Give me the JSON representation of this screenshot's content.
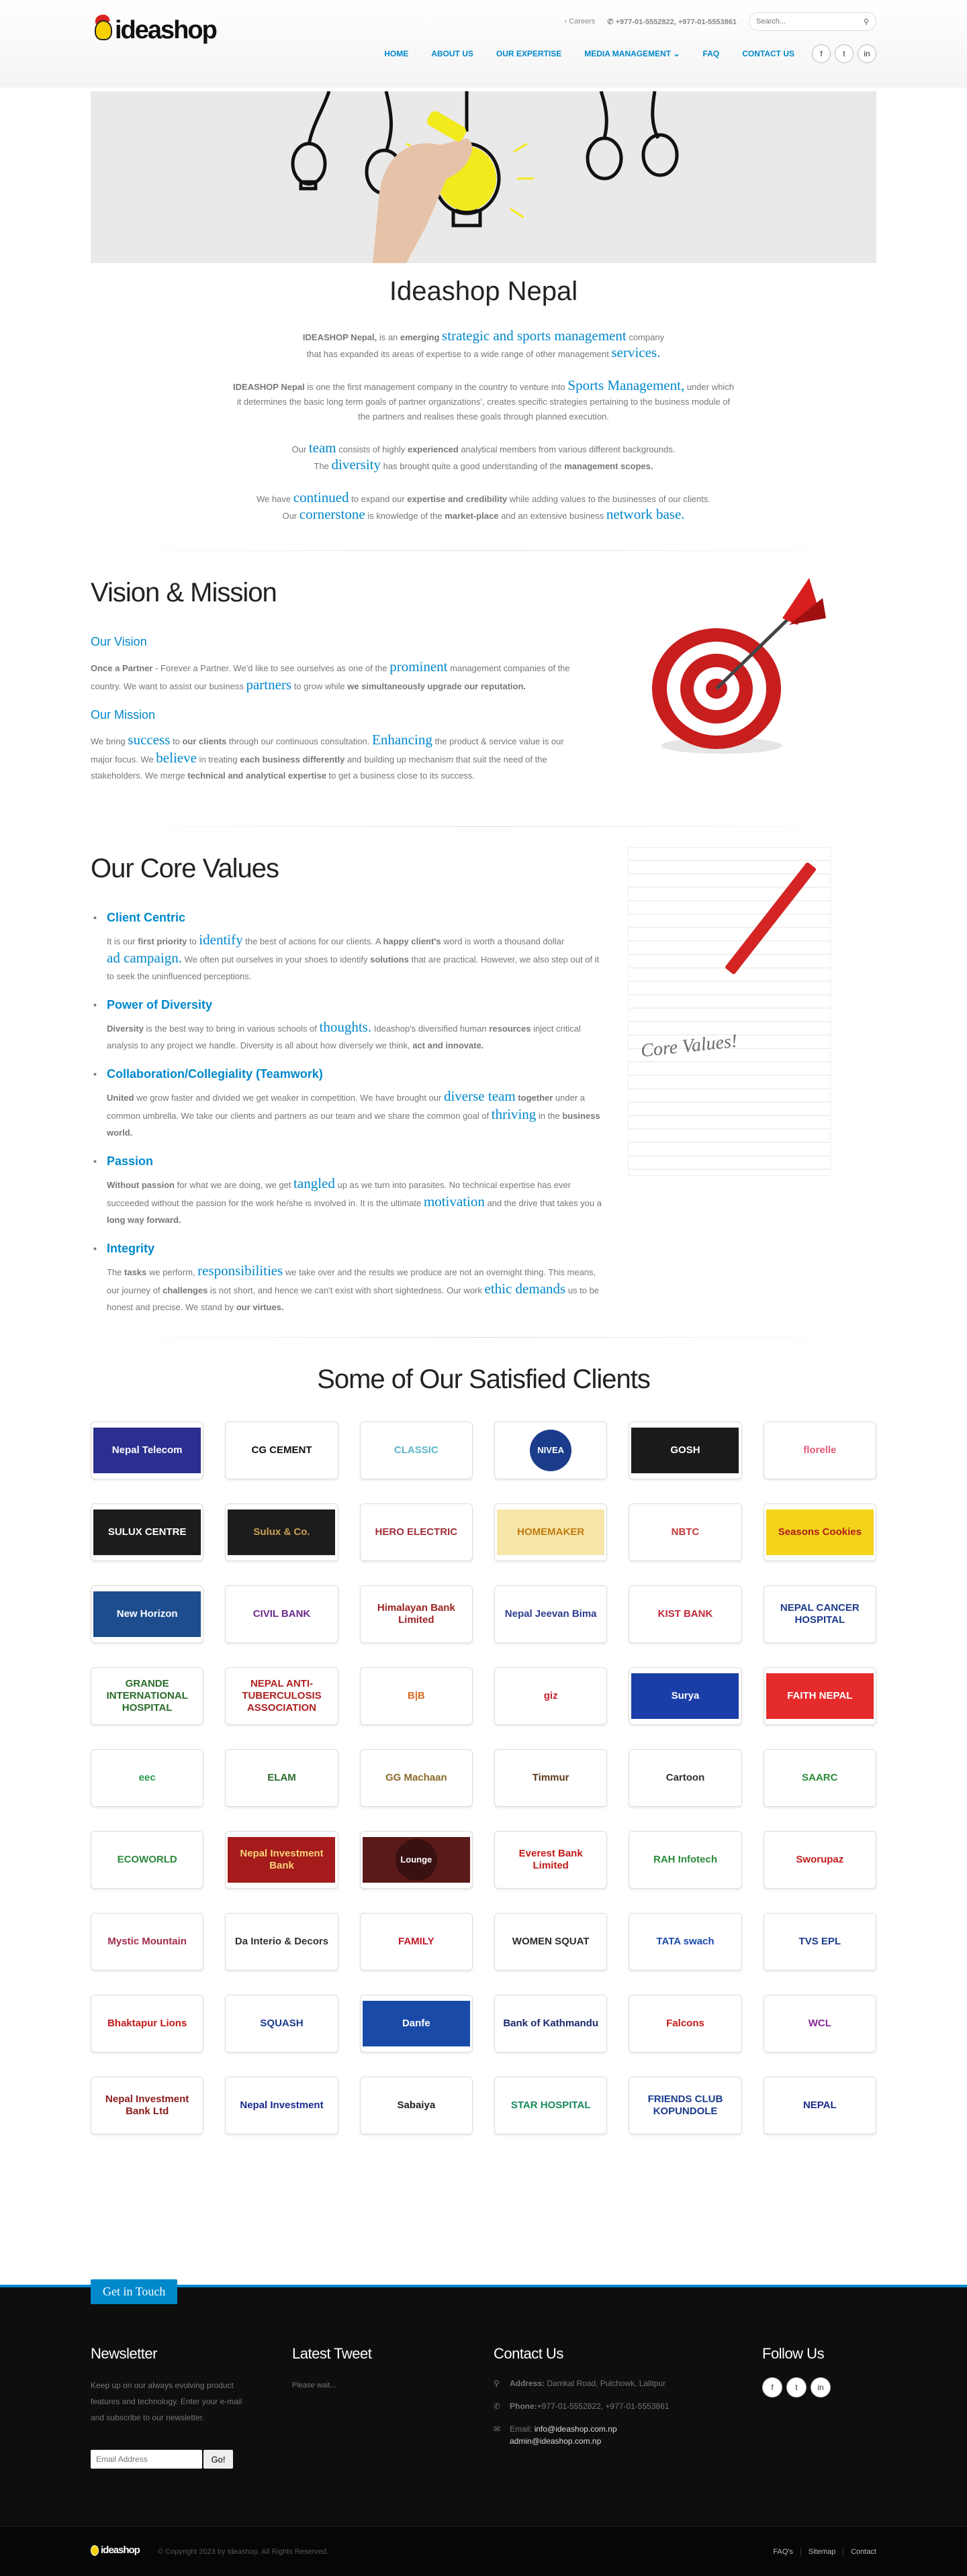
{
  "header": {
    "brand": "ideashop",
    "topbar": {
      "careers": "Careers",
      "phones": "+977-01-5552822, +977-01-5553861",
      "search_placeholder": "Search..."
    },
    "nav": [
      "HOME",
      "ABOUT US",
      "OUR EXPERTISE",
      "MEDIA MANAGEMENT",
      "FAQ",
      "CONTACT US"
    ]
  },
  "page_title": "Ideashop Nepal",
  "intro": {
    "p1": {
      "a": "IDEASHOP Nepal,",
      "b": " is an ",
      "c": "emerging",
      "d": "strategic and sports management",
      "e": " company",
      "f": "that has expanded its areas of expertise to a wide range of other management",
      "g": "services."
    },
    "p2": {
      "a": "IDEASHOP Nepal",
      "b": " is one the first management company in the country to venture into ",
      "c": "Sports Management,",
      "d": " under which",
      "e": "it determines the basic long term goals of partner organizations', creates specific strategies pertaining to the business module of",
      "f": "the partners and realises these goals through planned execution."
    },
    "p3": {
      "a": "Our ",
      "b": "team",
      "c": " consists of highly ",
      "d": "experienced",
      "e": " analytical members from various different backgrounds.",
      "f": "The ",
      "g": "diversity",
      "h": " has brought quite a good understanding of the ",
      "i": "management scopes."
    },
    "p4": {
      "a": "We have ",
      "b": "continued",
      "c": " to expand our ",
      "d": "expertise and credibility",
      "e": " while adding values to the businesses of our clients.",
      "f": "Our ",
      "g": "cornerstone",
      "h": " is knowledge of the ",
      "i": "market-place",
      "j": " and an extensive business ",
      "k": "network base."
    }
  },
  "vision": {
    "title": "Vision & Mission",
    "vision_h": "Our Vision",
    "v": {
      "a": "Once a Partner",
      "b": " - Forever a Partner. We'd like to see ourselves as one of the ",
      "c": "prominent",
      "d": " management companies of the",
      "e": "country. We want to assist our business ",
      "f": "partners",
      "g": " to grow while ",
      "h": "we simultaneously upgrade our reputation."
    },
    "mission_h": "Our Mission",
    "m": {
      "a": "We bring ",
      "b": "success",
      "c": " to ",
      "d": "our clients",
      "e": " through our continuous consultation. ",
      "f": "Enhancing",
      "g": " the product & service value is our",
      "h": "major focus. We ",
      "i": "believe",
      "j": " in treating ",
      "k": "each business differently",
      "l": " and building up mechanism that suit the need of the",
      "m": "stakeholders. We merge ",
      "n": "technical and analytical expertise",
      "o": " to get a business close to its success."
    }
  },
  "core": {
    "title": "Our Core Values",
    "image_caption": "Core Values!",
    "items": [
      {
        "h": "Client Centric",
        "t": [
          [
            "It is our ",
            0
          ],
          [
            "first priority",
            1
          ],
          [
            " to ",
            0
          ],
          [
            "identify",
            2
          ],
          [
            " the best of actions for our clients. A ",
            0
          ],
          [
            "happy client's",
            1
          ],
          [
            " word is worth a thousand dollar",
            0
          ],
          [
            "\n",
            0
          ],
          [
            "ad campaign.",
            2
          ],
          [
            " We often put ourselves in your shoes to identify ",
            0
          ],
          [
            "solutions",
            1
          ],
          [
            " that are practical. However, we also step out of it to seek the uninfluenced perceptions.",
            0
          ]
        ]
      },
      {
        "h": "Power of Diversity",
        "t": [
          [
            "Diversity",
            1
          ],
          [
            " is the best way to bring in various schools of ",
            0
          ],
          [
            "thoughts.",
            2
          ],
          [
            " Ideashop's diversified human ",
            0
          ],
          [
            "resources",
            1
          ],
          [
            " inject critical analysis to any project we handle. Diversity is all about how diversely we think, ",
            0
          ],
          [
            "act and innovate.",
            1
          ]
        ]
      },
      {
        "h": "Collaboration/Collegiality (Teamwork)",
        "t": [
          [
            "United",
            1
          ],
          [
            " we grow faster and divided we get weaker in competition. We have brought our ",
            0
          ],
          [
            "diverse team",
            2
          ],
          [
            " ",
            0
          ],
          [
            "together",
            1
          ],
          [
            " under a common umbrella. We take our clients and partners as our team and we share the common goal of ",
            0
          ],
          [
            "thriving",
            2
          ],
          [
            " in the ",
            0
          ],
          [
            "business world.",
            1
          ]
        ]
      },
      {
        "h": "Passion",
        "t": [
          [
            "Without passion",
            1
          ],
          [
            " for what we are doing, we get ",
            0
          ],
          [
            "tangled",
            2
          ],
          [
            " up as we turn into parasites. No technical expertise has ever succeeded without the passion for the work he/she is involved in. It is the ultimate ",
            0
          ],
          [
            "motivation",
            2
          ],
          [
            " and the drive that takes you a ",
            0
          ],
          [
            "long way forward.",
            1
          ]
        ]
      },
      {
        "h": "Integrity",
        "t": [
          [
            "The ",
            0
          ],
          [
            "tasks",
            1
          ],
          [
            " we perform, ",
            0
          ],
          [
            "responsibilities",
            2
          ],
          [
            " we take over and the results we produce are not an overnight thing. This means, our journey of ",
            0
          ],
          [
            "challenges",
            1
          ],
          [
            " is not short, and hence we can't exist with short sightedness. Our work ",
            0
          ],
          [
            "ethic demands",
            2
          ],
          [
            " us to be honest and precise. We stand by ",
            0
          ],
          [
            "our virtues.",
            1
          ]
        ]
      }
    ]
  },
  "clients": {
    "title": "Some of Our Satisfied Clients",
    "logos": [
      {
        "t": "Nepal Telecom",
        "bg": "#2b2f8f",
        "fg": "#fff"
      },
      {
        "t": "CG CEMENT",
        "bg": "#fff",
        "fg": "#111"
      },
      {
        "t": "CLASSIC",
        "bg": "#fff",
        "fg": "#5bb5c8"
      },
      {
        "t": "NIVEA",
        "bg": "#fff",
        "fg": "#fff",
        "circle": "#1a3c8b"
      },
      {
        "t": "GOSH",
        "bg": "#1a1a1a",
        "fg": "#fff"
      },
      {
        "t": "florelle",
        "bg": "#fff",
        "fg": "#e05a7a"
      },
      {
        "t": "SULUX CENTRE",
        "bg": "#1c1c1c",
        "fg": "#fff"
      },
      {
        "t": "Sulux & Co.",
        "bg": "#1c1c1c",
        "fg": "#c9a253"
      },
      {
        "t": "HERO ELECTRIC",
        "bg": "#fff",
        "fg": "#a0303a"
      },
      {
        "t": "HOMEMAKER",
        "bg": "#f7e6a8",
        "fg": "#c07a10"
      },
      {
        "t": "NBTC",
        "bg": "#fff",
        "fg": "#c23a3a"
      },
      {
        "t": "Seasons Cookies",
        "bg": "#f3d41a",
        "fg": "#b01c1c"
      },
      {
        "t": "New Horizon",
        "bg": "#1d4d8e",
        "fg": "#fff"
      },
      {
        "t": "CIVIL BANK",
        "bg": "#fff",
        "fg": "#6a2c8c"
      },
      {
        "t": "Himalayan Bank Limited",
        "bg": "#fff",
        "fg": "#9a2222"
      },
      {
        "t": "Nepal Jeevan Bima",
        "bg": "#fff",
        "fg": "#2b3e8e"
      },
      {
        "t": "KIST BANK",
        "bg": "#fff",
        "fg": "#c02a3a"
      },
      {
        "t": "NEPAL CANCER HOSPITAL",
        "bg": "#fff",
        "fg": "#1d3b8c"
      },
      {
        "t": "GRANDE INTERNATIONAL HOSPITAL",
        "bg": "#fff",
        "fg": "#2a6b2a"
      },
      {
        "t": "NEPAL ANTI-TUBERCULOSIS ASSOCIATION",
        "bg": "#fff",
        "fg": "#b02020"
      },
      {
        "t": "B|B",
        "bg": "#fff",
        "fg": "#d96a22"
      },
      {
        "t": "giz",
        "bg": "#fff",
        "fg": "#c7202f"
      },
      {
        "t": "Surya",
        "bg": "#1a3ea8",
        "fg": "#fff"
      },
      {
        "t": "FAITH NEPAL",
        "bg": "#e52b2b",
        "fg": "#fff"
      },
      {
        "t": "eec",
        "bg": "#fff",
        "fg": "#2a9a4a"
      },
      {
        "t": "ELAM",
        "bg": "#fff",
        "fg": "#2a6b2a"
      },
      {
        "t": "GG Machaan",
        "bg": "#fff",
        "fg": "#8a6a2a"
      },
      {
        "t": "Timmur",
        "bg": "#fff",
        "fg": "#5a3a1a"
      },
      {
        "t": "Cartoon",
        "bg": "#fff",
        "fg": "#333"
      },
      {
        "t": "SAARC",
        "bg": "#fff",
        "fg": "#2a8a3a"
      },
      {
        "t": "ECOWORLD",
        "bg": "#fff",
        "fg": "#2a8a3a"
      },
      {
        "t": "Nepal Investment Bank",
        "bg": "#a51a1a",
        "fg": "#f5d37a"
      },
      {
        "t": "Lounge",
        "bg": "#5a1a1a",
        "fg": "#fff",
        "circle": "#3a1010"
      },
      {
        "t": "Everest Bank Limited",
        "bg": "#fff",
        "fg": "#c21a1a"
      },
      {
        "t": "RAH Infotech",
        "bg": "#fff",
        "fg": "#2a8a3a"
      },
      {
        "t": "Sworupaz",
        "bg": "#fff",
        "fg": "#c21a1a"
      },
      {
        "t": "Mystic Mountain",
        "bg": "#fff",
        "fg": "#a02a4a"
      },
      {
        "t": "Da Interio & Decors",
        "bg": "#fff",
        "fg": "#333"
      },
      {
        "t": "FAMILY",
        "bg": "#fff",
        "fg": "#c21a2a"
      },
      {
        "t": "WOMEN SQUAT",
        "bg": "#fff",
        "fg": "#2a2a2a"
      },
      {
        "t": "TATA swach",
        "bg": "#fff",
        "fg": "#1a4aa8"
      },
      {
        "t": "TVS EPL",
        "bg": "#fff",
        "fg": "#1a3a8c"
      },
      {
        "t": "Bhaktapur Lions",
        "bg": "#fff",
        "fg": "#c21a1a"
      },
      {
        "t": "SQUASH",
        "bg": "#fff",
        "fg": "#1a3a8c"
      },
      {
        "t": "Danfe",
        "bg": "#1a4aa8",
        "fg": "#fff"
      },
      {
        "t": "Bank of Kathmandu",
        "bg": "#fff",
        "fg": "#1a2a6c"
      },
      {
        "t": "Falcons",
        "bg": "#fff",
        "fg": "#c21a1a"
      },
      {
        "t": "WCL",
        "bg": "#fff",
        "fg": "#8a2a9a"
      },
      {
        "t": "Nepal Investment Bank Ltd",
        "bg": "#fff",
        "fg": "#8a1a1a"
      },
      {
        "t": "Nepal Investment",
        "bg": "#fff",
        "fg": "#1a2a8c"
      },
      {
        "t": "Sabaiya",
        "bg": "#fff",
        "fg": "#222"
      },
      {
        "t": "STAR HOSPITAL",
        "bg": "#fff",
        "fg": "#1a8a5a"
      },
      {
        "t": "FRIENDS CLUB KOPUNDOLE",
        "bg": "#fff",
        "fg": "#1a3a8c"
      },
      {
        "t": "NEPAL",
        "bg": "#fff",
        "fg": "#1a2a8c"
      }
    ]
  },
  "footer": {
    "get_in_touch": "Get in Touch",
    "newsletter": {
      "title": "Newsletter",
      "text": "Keep up on our always evolving product features and technology. Enter your e-mail and subscribe to our newsletter.",
      "placeholder": "Email Address",
      "button": "Go!"
    },
    "tweet": {
      "title": "Latest Tweet",
      "text": "Please wait..."
    },
    "contact": {
      "title": "Contact Us",
      "address_label": "Address:",
      "address": " Damkal Road, Pulchowk, Lalitpur",
      "phone_label": "Phone:",
      "phone": "+977-01-5552822, +977-01-5553861",
      "email_label": "Email:",
      "email1": "info@ideashop.com.np",
      "email2": "admin@ideashop.com.np"
    },
    "follow": {
      "title": "Follow Us"
    },
    "copyright": "© Copyright 2023 by Ideashop. All Rights Reserved.",
    "links": [
      "FAQ's",
      "Sitemap",
      "Contact"
    ],
    "brand": "ideashop"
  },
  "colors": {
    "accent": "#0088cc",
    "dark": "#0e0e0e"
  }
}
